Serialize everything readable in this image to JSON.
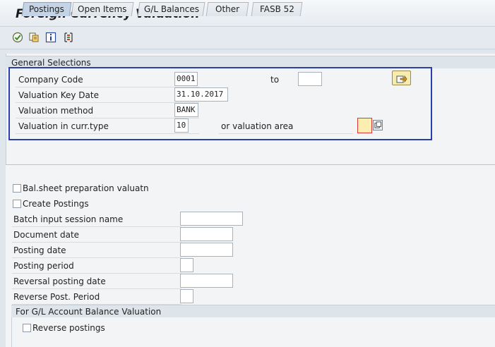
{
  "title": "Foreign Currency Valuation",
  "toolbar": {
    "icons": [
      "execute-icon",
      "variant-icon",
      "info-icon",
      "selection-options-icon"
    ]
  },
  "general_selections": {
    "header": "General Selections",
    "company_code": {
      "label": "Company Code",
      "value": "0001",
      "to_label": "to",
      "to_value": ""
    },
    "valuation_key_date": {
      "label": "Valuation Key Date",
      "value": "31.10.2017"
    },
    "valuation_method": {
      "label": "Valuation method",
      "value": "BANK"
    },
    "valuation_curr_type": {
      "label": "Valuation in curr.type",
      "value": "10",
      "area_label": "or valuation area",
      "area_value": ""
    }
  },
  "tabs": [
    {
      "label": "Postings",
      "active": true
    },
    {
      "label": "Open Items",
      "active": false
    },
    {
      "label": "G/L Balances",
      "active": false
    },
    {
      "label": "Other",
      "active": false
    },
    {
      "label": "FASB 52",
      "active": false
    }
  ],
  "postings": {
    "bal_sheet_label": "Bal.sheet preparation valuatn",
    "create_postings_label": "Create Postings",
    "batch_input_label": "Batch input session name",
    "document_date_label": "Document date",
    "posting_date_label": "Posting date",
    "posting_period_label": "Posting period",
    "reversal_posting_date_label": "Reversal posting date",
    "reverse_post_period_label": "Reverse Post. Period"
  },
  "gl_balance_section": {
    "header": "For G/L Account Balance Valuation",
    "reverse_postings_label": "Reverse postings"
  }
}
